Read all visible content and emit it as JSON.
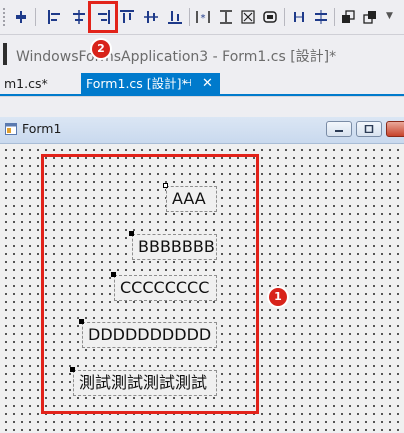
{
  "toolbar": {
    "buttons": [
      {
        "name": "align-to-grid-icon"
      },
      {
        "name": "align-lefts-icon"
      },
      {
        "name": "align-centers-icon"
      },
      {
        "name": "align-rights-icon"
      },
      {
        "name": "align-tops-icon"
      },
      {
        "name": "align-middles-icon"
      },
      {
        "name": "align-bottoms-icon"
      },
      {
        "name": "make-same-width-icon"
      },
      {
        "name": "make-same-height-icon"
      },
      {
        "name": "make-same-size-icon"
      },
      {
        "name": "size-to-grid-icon"
      },
      {
        "name": "make-horizontal-spacing-equal-icon"
      },
      {
        "name": "make-vertical-spacing-equal-icon"
      },
      {
        "name": "bring-to-front-icon"
      },
      {
        "name": "send-to-back-icon"
      }
    ],
    "overflow": "▼"
  },
  "window": {
    "title": "WindowsFormsApplication3 - Form1.cs [設計]*"
  },
  "tabs": {
    "code_tab": "m1.cs*",
    "design_tab": "Form1.cs [設計]*",
    "pin": "⊣",
    "close": "✕"
  },
  "form": {
    "title": "Form1",
    "labels": [
      "AAA",
      "BBBBBBB",
      "CCCCCCCC",
      "DDDDDDDDDD",
      "測試測試測試測試"
    ]
  },
  "annotations": {
    "badge_1": "1",
    "badge_2": "2"
  },
  "colors": {
    "accent": "#007acc",
    "annotation_red": "#e2231a"
  }
}
